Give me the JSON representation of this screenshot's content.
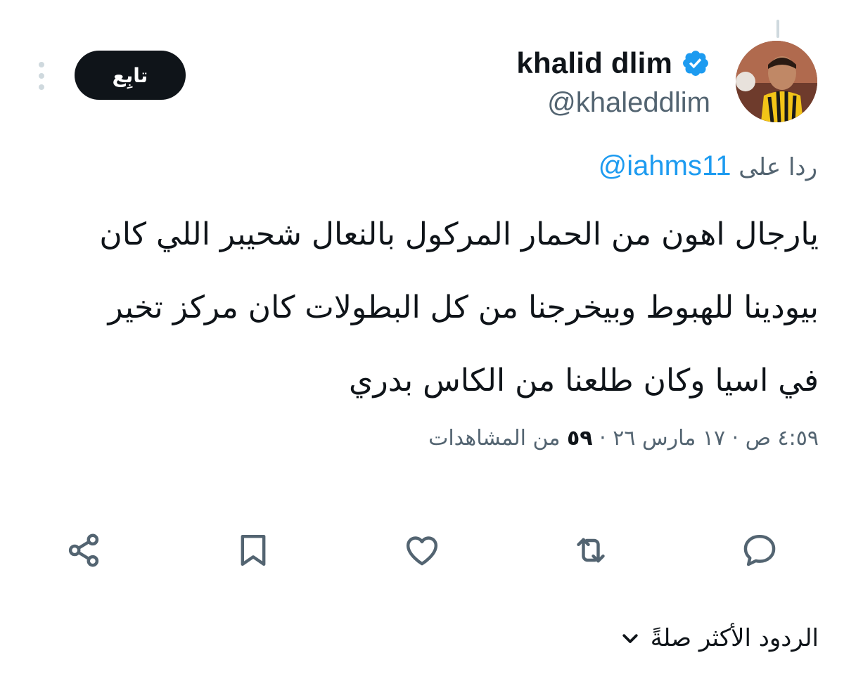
{
  "author": {
    "display_name": "khalid dlim",
    "handle": "@khaleddlim",
    "verified": true
  },
  "follow_button": {
    "label": "تابِع"
  },
  "reply_to": {
    "prefix": "ردا على",
    "mention": "@iahms11"
  },
  "tweet": {
    "lines": [
      "يارجال اهون من الحمار المركول بالنعال شحيبر اللي كان",
      "بيودينا للهبوط وبيخرجنا من كل البطولات كان مركز تخير",
      "في اسيا وكان طلعنا من الكاس بدري"
    ]
  },
  "meta": {
    "time": "٤:٥٩ ص",
    "separator": "·",
    "date": "١٧ مارس ٢٦",
    "views_count": "٥٩",
    "views_label": "من المشاهدات"
  },
  "actions": [
    {
      "name": "reply",
      "icon": "reply-icon"
    },
    {
      "name": "retweet",
      "icon": "retweet-icon"
    },
    {
      "name": "like",
      "icon": "like-icon"
    },
    {
      "name": "bookmark",
      "icon": "bookmark-icon"
    },
    {
      "name": "share",
      "icon": "share-icon"
    }
  ],
  "replies_sort": {
    "label": "الردود الأكثر صلةً"
  },
  "colors": {
    "text": "#0f1419",
    "secondary": "#536471",
    "accent": "#1d9bf0",
    "follow_bg": "#0f1419"
  }
}
